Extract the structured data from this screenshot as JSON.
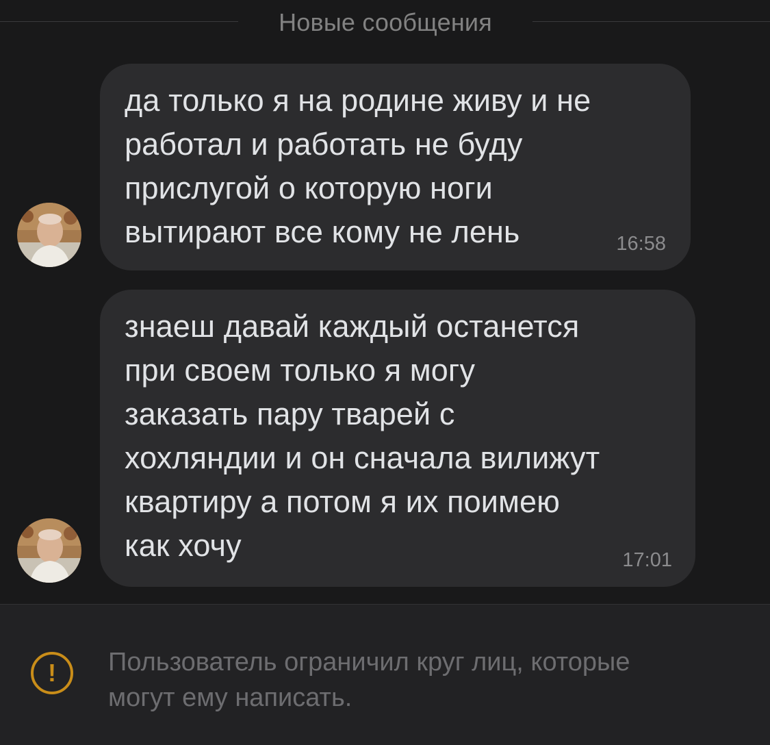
{
  "divider": {
    "label": "Новые сообщения"
  },
  "messages": [
    {
      "text": "да только я на родине живу и не\nработал и работать не буду\nприслугой о которую ноги\nвытирают все кому не лень",
      "time": "16:58"
    },
    {
      "text": "знаеш давай каждый останется\nпри своем только я могу\nзаказать пару тварей с\nхохляндии и он сначала вилижут\nквартиру а потом я их поимею\nкак хочу",
      "time": "17:01"
    }
  ],
  "footer": {
    "icon": "exclamation-circle-icon",
    "icon_glyph": "!",
    "notice": "Пользователь ограничил круг лиц, которые\nмогут ему написать."
  },
  "colors": {
    "background": "#19191a",
    "bubble": "#2c2c2e",
    "warning": "#c98d19"
  }
}
